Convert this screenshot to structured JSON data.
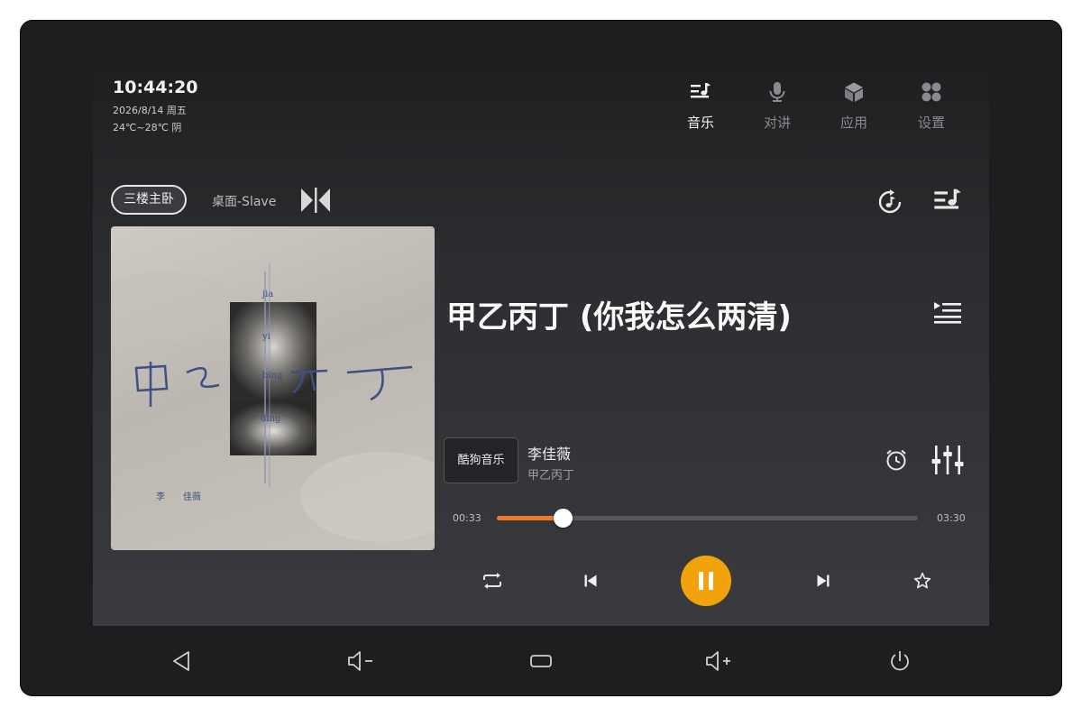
{
  "status": {
    "time": "10:44:20",
    "date": "2026/8/14 周五",
    "weather": "24℃~28℃ 阴"
  },
  "nav": {
    "tabs": [
      {
        "label": "音乐",
        "icon": "music-queue-icon",
        "active": true
      },
      {
        "label": "对讲",
        "icon": "microphone-icon",
        "active": false
      },
      {
        "label": "应用",
        "icon": "cube-icon",
        "active": false
      },
      {
        "label": "设置",
        "icon": "grid-settings-icon",
        "active": false
      }
    ]
  },
  "rooms": {
    "selected": "三楼主卧",
    "other": "桌面-Slave"
  },
  "album_art": {
    "title_lettering": "甲乙丙丁",
    "pinyin": [
      "jia",
      "yi",
      "bing",
      "ding"
    ],
    "artist_lettering": "李 佳薇"
  },
  "track": {
    "title": "甲乙丙丁 (你我怎么两清)",
    "artist": "李佳薇",
    "album": "甲乙丙丁",
    "source": "酷狗音乐"
  },
  "progress": {
    "current": "00:33",
    "total": "03:30",
    "fraction": 0.157
  },
  "colors": {
    "accent_progress": "#ee7a2a",
    "play_button": "#f2a30b",
    "screen_bg": "#2c2d30",
    "bezel": "#1e1e20"
  },
  "controls": {
    "repeat": "repeat-icon",
    "previous": "skip-previous-icon",
    "play_pause": "pause-icon",
    "next": "skip-next-icon",
    "favorite": "star-icon"
  },
  "system_bar": [
    "back-triangle-icon",
    "volume-down-icon",
    "home-icon",
    "volume-up-icon",
    "power-icon"
  ]
}
